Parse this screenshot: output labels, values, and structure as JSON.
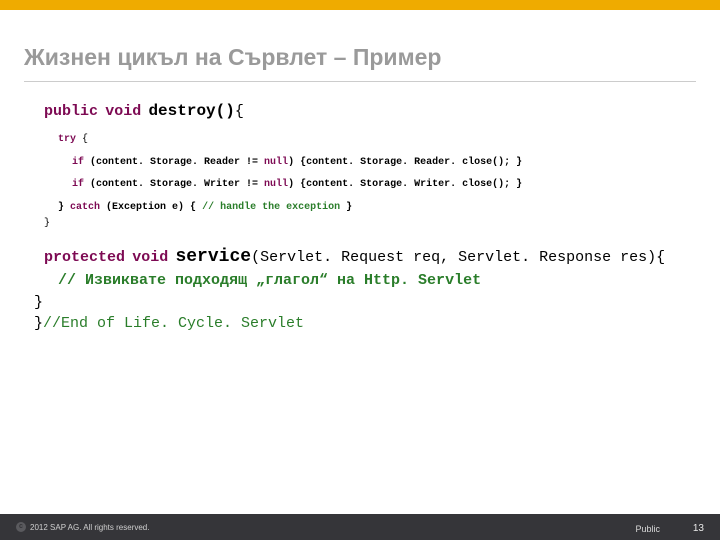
{
  "slide": {
    "title": "Жизнен цикъл на Сървлет  –  Пример"
  },
  "code": {
    "destroy_sig_kw1": "public",
    "destroy_sig_kw2": "void",
    "destroy_sig_name": "destroy()",
    "destroy_sig_brace": "{",
    "try_kw": "try",
    "try_brace": " {",
    "if1_kw": "if",
    "if1_cond": " (content. Storage. Reader != ",
    "if1_null": "null",
    "if1_after": ") {content. Storage. Reader. close(); }",
    "if2_kw": "if",
    "if2_cond": " (content. Storage. Writer != ",
    "if2_null": "null",
    "if2_after": ") {content. Storage. Writer. close(); }",
    "catch_close": "} ",
    "catch_kw": "catch",
    "catch_args": " (Exception e) { ",
    "catch_cm": "// handle the exception",
    "catch_end": " }",
    "close_destroy": "}",
    "service_kw1": "protected",
    "service_kw2": "void",
    "service_name": "service",
    "service_args": "(Servlet. Request req, Servlet. Response res){",
    "service_cm": "// Извиквате подходящ „глагол“ на Http. Servlet",
    "close_service": " }",
    "close_class_brace": "}",
    "close_class_cm": "//End of Life. Cycle. Servlet"
  },
  "footer": {
    "copyright": "2012 SAP AG. All rights reserved.",
    "classification": "Public",
    "page": "13"
  }
}
